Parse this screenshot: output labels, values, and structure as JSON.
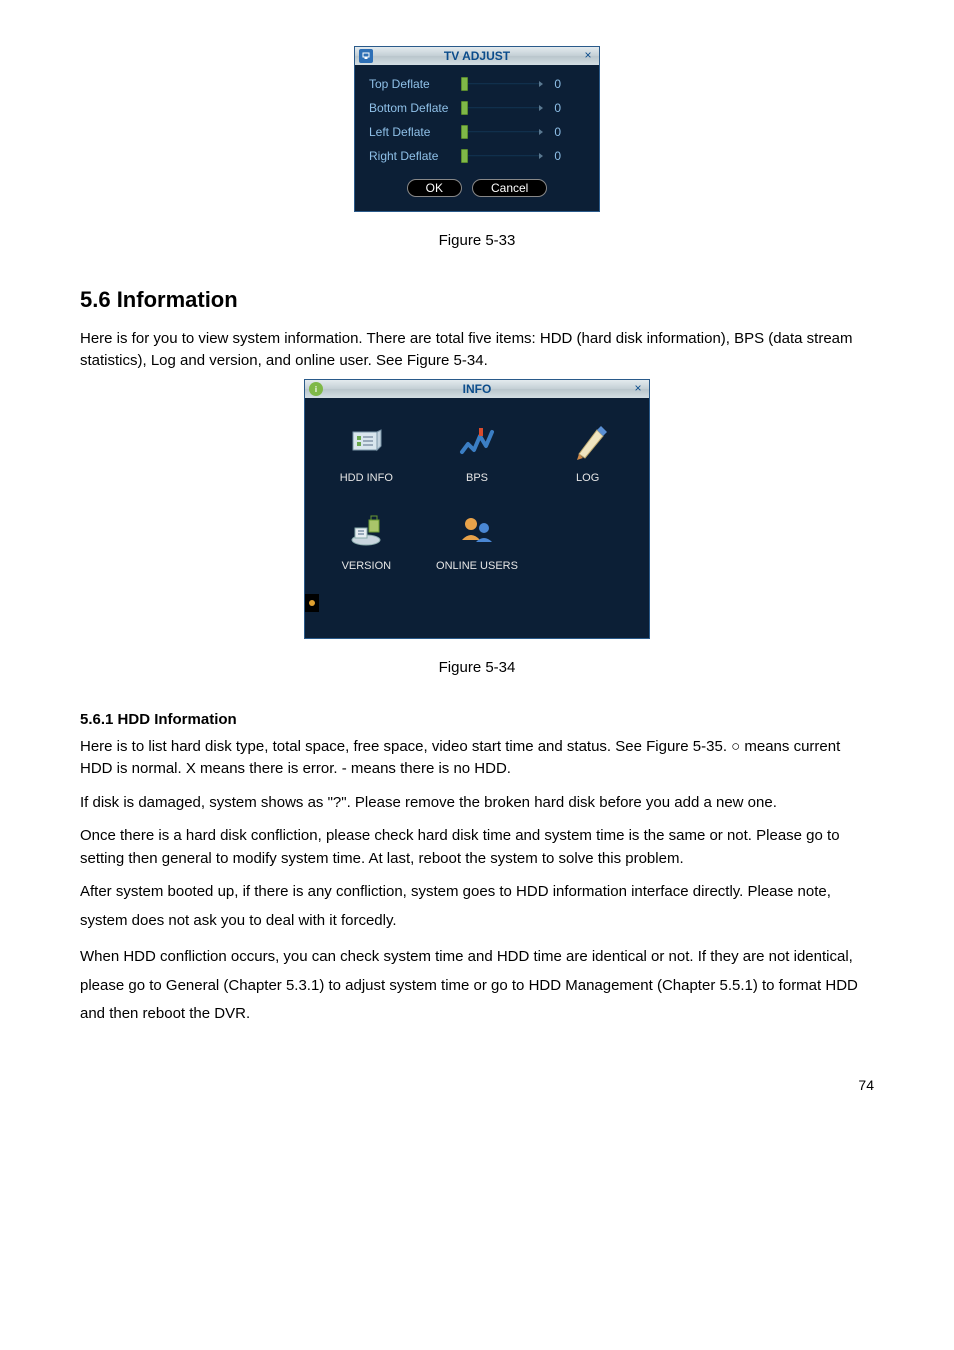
{
  "tv_adjust": {
    "title": "TV ADJUST",
    "rows": [
      {
        "label": "Top Deflate",
        "value": "0"
      },
      {
        "label": "Bottom Deflate",
        "value": "0"
      },
      {
        "label": "Left Deflate",
        "value": "0"
      },
      {
        "label": "Right Deflate",
        "value": "0"
      }
    ],
    "ok": "OK",
    "cancel": "Cancel"
  },
  "fig1": "Figure 5-33",
  "section_heading": "5.6  Information",
  "section_body": "Here is for you to view system information. There are total five items: HDD (hard disk information), BPS (data stream statistics), Log and version, and online user. See Figure 5-34.",
  "info_win": {
    "title": "INFO",
    "items": [
      {
        "label": "HDD INFO"
      },
      {
        "label": "BPS"
      },
      {
        "label": "LOG"
      },
      {
        "label": "VERSION"
      },
      {
        "label": "ONLINE USERS"
      }
    ]
  },
  "fig2": "Figure 5-34",
  "sub_heading": "5.6.1  HDD Information",
  "p1": "Here is to list hard disk type, total space, free space, video start time and status. See Figure 5-35. ○ means current HDD is normal. X means there is error. - means there is no HDD.",
  "p2": "If disk is damaged, system shows as \"?\". Please remove the broken hard disk before you add a new one.",
  "p3": "Once there is a hard disk confliction, please check hard disk time and system time is the same or not. Please go to setting then general to modify system time.  At last, reboot the system to solve this problem.",
  "p4": "After system booted up, if there is any confliction, system goes to HDD information interface directly. Please note, system does not ask you to deal with it forcedly.",
  "p5": "When HDD confliction occurs, you can check system time and HDD time are identical or not. If they are not identical, please go to General (Chapter 5.3.1) to adjust system time or go to HDD Management (Chapter 5.5.1) to format HDD and then reboot the DVR.",
  "page_number": "74"
}
